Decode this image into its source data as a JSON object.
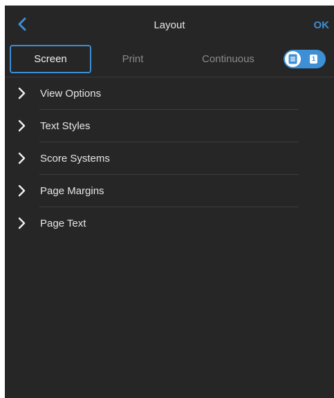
{
  "header": {
    "back_icon": "chevron-left-icon",
    "title": "Layout",
    "ok_label": "OK"
  },
  "tabs": [
    {
      "label": "Screen",
      "active": true
    },
    {
      "label": "Print",
      "active": false
    },
    {
      "label": "Continuous",
      "active": false
    }
  ],
  "view_toggle": {
    "on": true,
    "knob_icon": "document-icon",
    "side_icon": "page-number-icon",
    "side_text": "1"
  },
  "sections": [
    {
      "label": "View Options"
    },
    {
      "label": "Text Styles"
    },
    {
      "label": "Score Systems"
    },
    {
      "label": "Page Margins"
    },
    {
      "label": "Page Text"
    }
  ],
  "colors": {
    "background": "#262626",
    "accent": "#3d8fd6",
    "text": "#e6e6e6",
    "muted": "#8a8a8a"
  }
}
